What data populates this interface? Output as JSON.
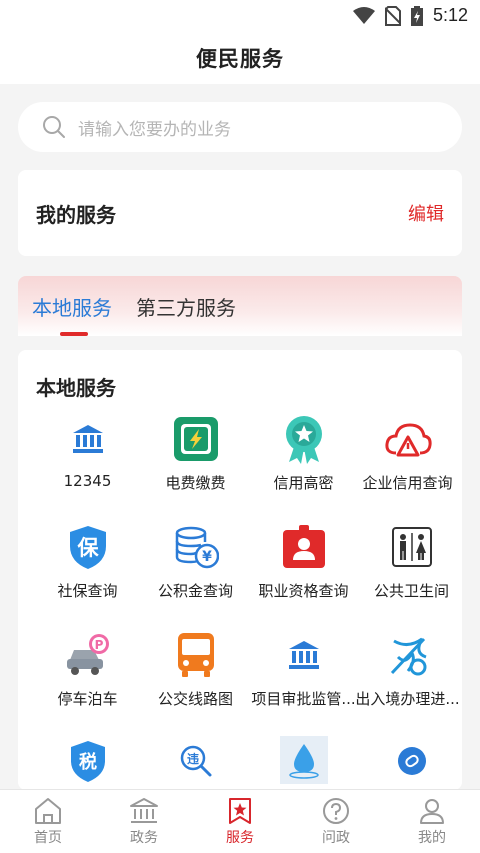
{
  "status_bar": {
    "time": "5:12",
    "icons": [
      "wifi-icon",
      "no-sim-icon",
      "battery-charging-icon"
    ]
  },
  "header": {
    "title": "便民服务"
  },
  "search": {
    "placeholder": "请输入您要办的业务",
    "icon": "search-icon"
  },
  "my_services": {
    "label": "我的服务",
    "edit_label": "编辑"
  },
  "tabs": [
    {
      "label": "本地服务",
      "active": true
    },
    {
      "label": "第三方服务",
      "active": false
    }
  ],
  "local_services": {
    "heading": "本地服务",
    "items": [
      {
        "label": "12345",
        "icon": "government-building-icon"
      },
      {
        "label": "电费缴费",
        "icon": "electricity-bill-icon"
      },
      {
        "label": "信用高密",
        "icon": "credit-badge-icon"
      },
      {
        "label": "企业信用查询",
        "icon": "cloud-warning-icon"
      },
      {
        "label": "社保查询",
        "icon": "social-security-shield-icon"
      },
      {
        "label": "公积金查询",
        "icon": "coin-stack-icon"
      },
      {
        "label": "职业资格查询",
        "icon": "id-badge-icon"
      },
      {
        "label": "公共卫生间",
        "icon": "restroom-icon"
      },
      {
        "label": "停车泊车",
        "icon": "parking-car-icon"
      },
      {
        "label": "公交线路图",
        "icon": "bus-icon"
      },
      {
        "label": "项目审批监管...",
        "icon": "government-building-icon"
      },
      {
        "label": "出入境办理进...",
        "icon": "caduceus-icon"
      },
      {
        "label": "",
        "icon": "tax-shield-icon"
      },
      {
        "label": "",
        "icon": "violation-search-icon"
      },
      {
        "label": "",
        "icon": "water-drop-icon"
      },
      {
        "label": "",
        "icon": "medicine-icon"
      }
    ]
  },
  "bottom_nav": [
    {
      "label": "首页",
      "icon": "home-icon",
      "active": false
    },
    {
      "label": "政务",
      "icon": "government-icon",
      "active": false
    },
    {
      "label": "服务",
      "icon": "service-bookmark-icon",
      "active": true
    },
    {
      "label": "问政",
      "icon": "question-icon",
      "active": false
    },
    {
      "label": "我的",
      "icon": "user-icon",
      "active": false
    }
  ],
  "colors": {
    "accent_red": "#e02a2a",
    "accent_blue": "#2b7bd6",
    "nav_active": "#d8262c"
  }
}
